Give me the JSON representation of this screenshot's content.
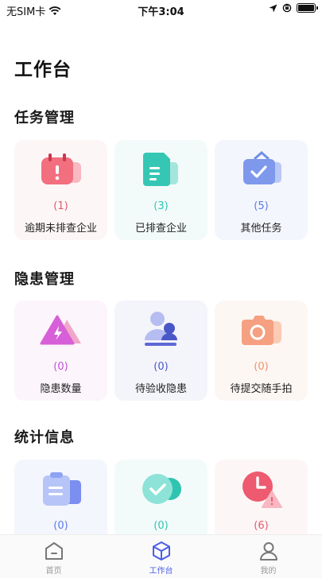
{
  "status_bar": {
    "carrier": "无SIM卡",
    "time": "下午3:04"
  },
  "page": {
    "title": "工作台"
  },
  "sections": {
    "tasks": {
      "title": "任务管理",
      "cards": [
        {
          "count": "(1)",
          "label": "逾期未排查企业",
          "color": "#e05a6b",
          "icon": "calendar-icon"
        },
        {
          "count": "(3)",
          "label": "已排查企业",
          "color": "#2fc4b2",
          "icon": "document-icon"
        },
        {
          "count": "(5)",
          "label": "其他任务",
          "color": "#5a7be8",
          "icon": "briefcase-check-icon"
        }
      ]
    },
    "hazards": {
      "title": "隐患管理",
      "cards": [
        {
          "count": "(0)",
          "label": "隐患数量",
          "color": "#c04fd6",
          "icon": "warning-bolt-icon"
        },
        {
          "count": "(0)",
          "label": "待验收隐患",
          "color": "#4a57c8",
          "icon": "inspector-icon"
        },
        {
          "count": "(0)",
          "label": "待提交随手拍",
          "color": "#f0906a",
          "icon": "camera-icon"
        }
      ]
    },
    "stats": {
      "title": "统计信息",
      "cards": [
        {
          "count": "(0)",
          "label": "",
          "color": "#5a7be8",
          "icon": "clipboard-icon"
        },
        {
          "count": "(0)",
          "label": "",
          "color": "#2fc4b2",
          "icon": "check-circle-icon"
        },
        {
          "count": "(6)",
          "label": "",
          "color": "#e05a6b",
          "icon": "clock-alert-icon"
        }
      ]
    }
  },
  "tab_bar": {
    "tabs": [
      {
        "label": "首页",
        "icon": "home-icon",
        "active": false
      },
      {
        "label": "工作台",
        "icon": "cube-icon",
        "active": true
      },
      {
        "label": "我的",
        "icon": "person-icon",
        "active": false
      }
    ]
  }
}
